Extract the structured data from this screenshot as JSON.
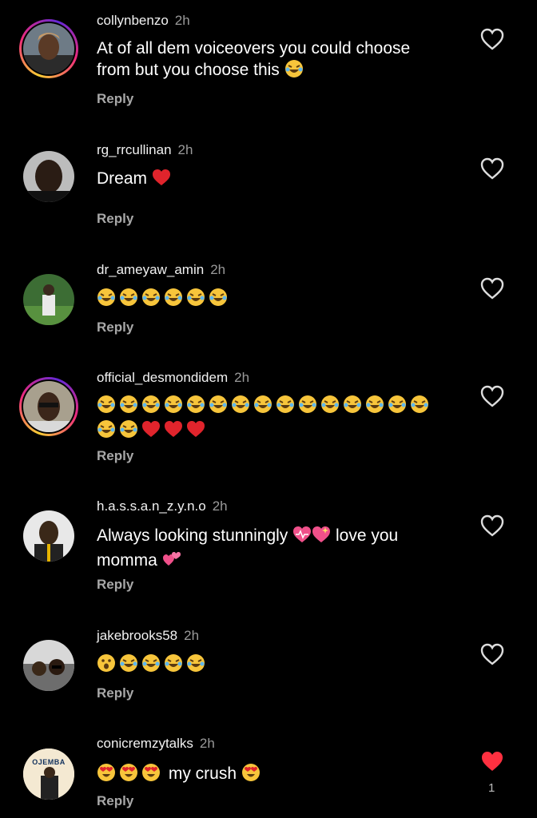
{
  "comments": [
    {
      "username": "collynbenzo",
      "time": "2h",
      "text": "At of all dem voiceovers you could choose from but you choose this",
      "emojis": [
        "laugh"
      ],
      "reply": "Reply",
      "liked": false,
      "story": true
    },
    {
      "username": "rg_rrcullinan",
      "time": "2h",
      "text": "Dream",
      "emojis": [
        "heart"
      ],
      "reply": "Reply",
      "liked": false,
      "story": false
    },
    {
      "username": "dr_ameyaw_amin",
      "time": "2h",
      "text": "",
      "emojis": [
        "laugh",
        "laugh",
        "laugh",
        "laugh",
        "laugh",
        "laugh"
      ],
      "reply": "Reply",
      "liked": false,
      "story": false
    },
    {
      "username": "official_desmondidem",
      "time": "2h",
      "text": "",
      "emojis": [
        "laugh",
        "laugh",
        "laugh",
        "laugh",
        "laugh",
        "laugh",
        "laugh",
        "laugh",
        "laugh",
        "laugh",
        "laugh",
        "laugh",
        "laugh",
        "laugh",
        "laugh",
        "laugh",
        "laugh",
        "heart",
        "heart",
        "heart"
      ],
      "reply": "Reply",
      "liked": false,
      "story": true
    },
    {
      "username": "h.a.s.s.a.n_z.y.n.o",
      "time": "2h",
      "text": "Always looking stunningly",
      "text2": "love you momma",
      "emojis": [
        "heartbeat",
        "sparkleheart"
      ],
      "reply": "Reply",
      "liked": false,
      "story": false
    },
    {
      "username": "jakebrooks58",
      "time": "2h",
      "text": "",
      "emojis": [
        "wow",
        "laugh",
        "laugh",
        "laugh",
        "laugh"
      ],
      "reply": "Reply",
      "liked": false,
      "story": false
    },
    {
      "username": "conicremzytalks",
      "time": "2h",
      "text": "my crush",
      "emojis": [
        "hearteyes",
        "hearteyes",
        "hearteyes"
      ],
      "reply": "Reply",
      "liked": true,
      "likes": "1",
      "story": false,
      "avatar_text": "OJEMBA"
    }
  ]
}
